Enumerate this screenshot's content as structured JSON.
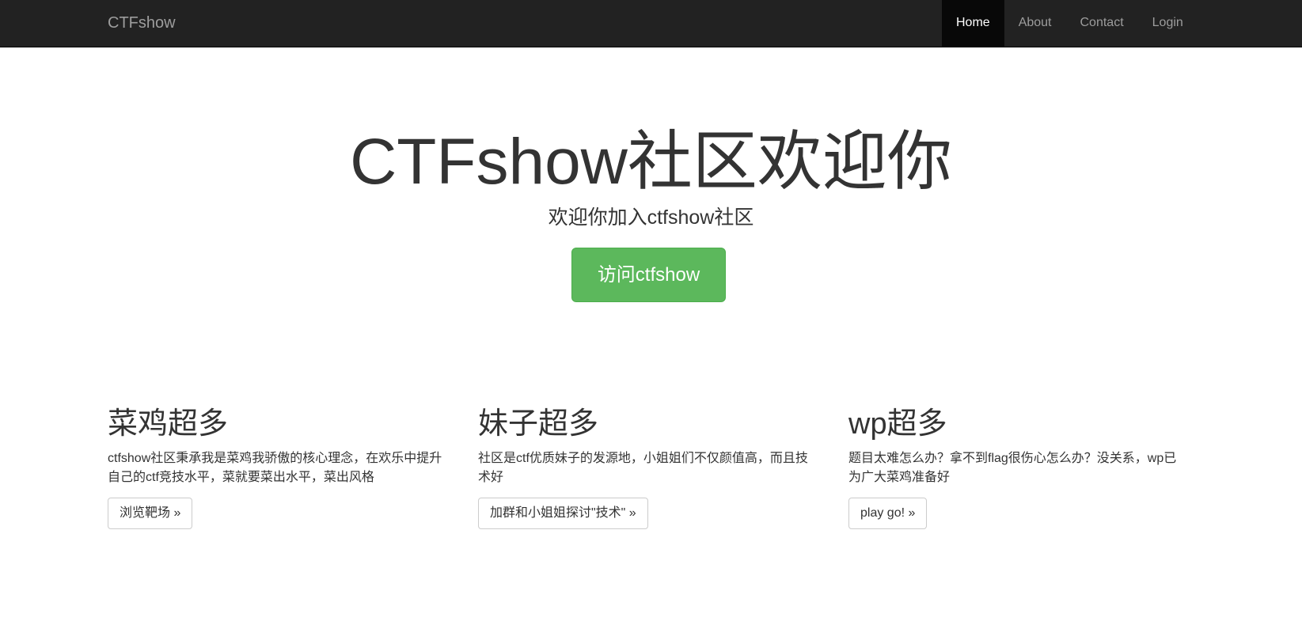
{
  "navbar": {
    "brand": "CTFshow",
    "items": [
      {
        "label": "Home",
        "active": true
      },
      {
        "label": "About",
        "active": false
      },
      {
        "label": "Contact",
        "active": false
      },
      {
        "label": "Login",
        "active": false
      }
    ]
  },
  "hero": {
    "title": "CTFshow社区欢迎你",
    "subtitle": "欢迎你加入ctfshow社区",
    "button_label": "访问ctfshow"
  },
  "features": [
    {
      "title": "菜鸡超多",
      "text": "ctfshow社区秉承我是菜鸡我骄傲的核心理念，在欢乐中提升自己的ctf竞技水平，菜就要菜出水平，菜出风格",
      "button_label": "浏览靶场 »"
    },
    {
      "title": "妹子超多",
      "text": "社区是ctf优质妹子的发源地，小姐姐们不仅颜值高，而且技术好",
      "button_label": "加群和小姐姐探讨\"技术\" »"
    },
    {
      "title": "wp超多",
      "text": "题目太难怎么办？拿不到flag很伤心怎么办？没关系，wp已为广大菜鸡准备好",
      "button_label": "play go! »"
    }
  ],
  "colors": {
    "navbar_bg": "#222222",
    "nav_active_bg": "#080808",
    "nav_text": "#9d9d9d",
    "success": "#5cb85c",
    "text": "#333333"
  }
}
